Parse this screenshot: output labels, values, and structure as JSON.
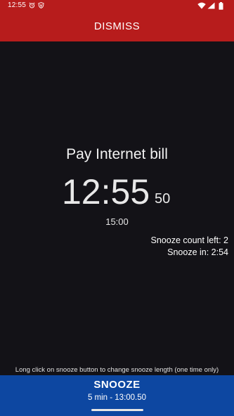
{
  "status_bar": {
    "time": "12:55",
    "icons": [
      "alarm-icon",
      "shield-icon",
      "wifi-icon",
      "signal-icon",
      "battery-icon"
    ]
  },
  "dismiss_button": {
    "label": "DISMISS"
  },
  "alarm": {
    "label": "Pay Internet bill",
    "clock_hm": "12:55",
    "clock_seconds": "50",
    "next_time": "15:00"
  },
  "snooze_info": {
    "count_left": "Snooze count left: 2",
    "snooze_in": "Snooze in: 2:54"
  },
  "hint": {
    "text": "Long click on snooze button to change snooze length (one time only)"
  },
  "snooze_button": {
    "label": "SNOOZE",
    "subtitle": "5 min - 13:00.50"
  },
  "colors": {
    "dismiss_bg": "#b71c1c",
    "snooze_bg": "#0d47a1",
    "screen_bg": "#131217"
  }
}
